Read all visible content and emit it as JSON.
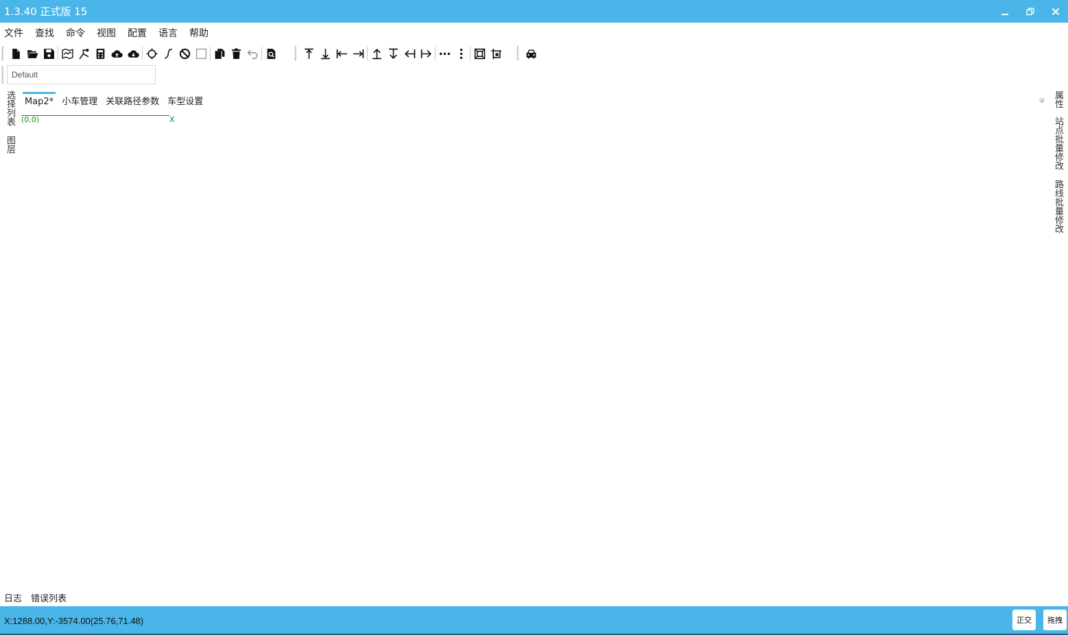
{
  "window": {
    "title": "1.3.40 正式版 15"
  },
  "menu": [
    "文件",
    "查找",
    "命令",
    "视图",
    "配置",
    "语言",
    "帮助"
  ],
  "toolbar": {
    "icons": [
      "new-file-icon",
      "open-folder-icon",
      "save-icon",
      "map-icon",
      "path-tool-icon",
      "calculator-icon",
      "cloud-upload-icon",
      "cloud-download-icon",
      "crosshair-icon",
      "curve-icon",
      "no-entry-icon",
      "rectangle-icon",
      "copy-icon",
      "delete-icon",
      "undo-icon",
      "search-doc-icon",
      "align-top-icon",
      "align-bottom-icon",
      "align-left-icon",
      "align-right-icon",
      "distribute-up-icon",
      "distribute-down-icon",
      "distribute-left-icon",
      "distribute-right-icon",
      "more-horizontal-icon",
      "more-vertical-icon",
      "fit-view-icon",
      "zoom-region-icon",
      "car-icon"
    ]
  },
  "layer": {
    "value": "Default"
  },
  "left_panel": {
    "tab1": "选择列表",
    "tab2": "图层"
  },
  "tabs": [
    "Map2*",
    "小车管理",
    "关联路径参数",
    "车型设置"
  ],
  "canvas": {
    "origin_label": "(0,0)",
    "x_axis_label": "X"
  },
  "right_panel": {
    "tab1": "属性",
    "tab2": "站点批量修改",
    "tab3": "路线批量修改"
  },
  "bottom_tabs": [
    "日志",
    "错误列表"
  ],
  "status": {
    "coords": "X:1288.00,Y:-3574.00(25.76,71.48)",
    "ortho_label": "正交",
    "drag_label": "拖拽"
  },
  "colors": {
    "accent": "#4ab5e8",
    "axis": "#0a8a1a"
  }
}
